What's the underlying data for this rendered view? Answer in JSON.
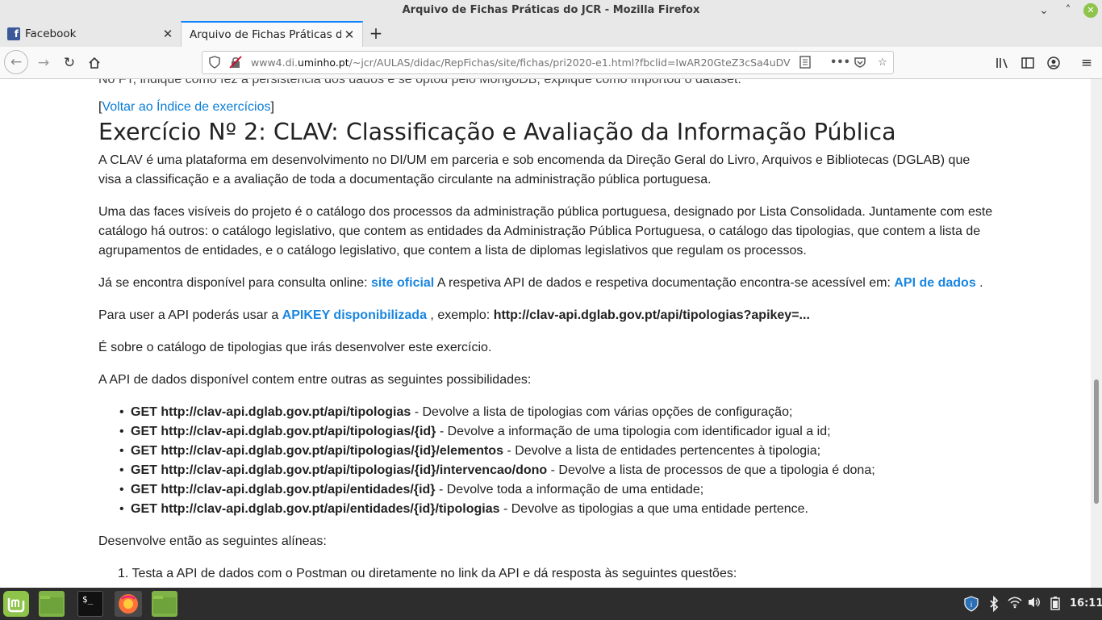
{
  "window": {
    "title": "Arquivo de Fichas Práticas do JCR - Mozilla Firefox"
  },
  "tabs": [
    {
      "label": "Facebook",
      "favicon": "facebook-icon"
    },
    {
      "label": "Arquivo de Fichas Práticas do J"
    }
  ],
  "nav": {
    "url_prefix": "www4.di.",
    "url_domain": "uminho.pt",
    "url_rest": "/~jcr/AULAS/didac/RepFichas/site/fichas/pri2020-e1.html?fbclid=IwAR20GteZ3cSa4uDV"
  },
  "content": {
    "cutoff_text": "No FT, indique como fez a persistência dos dados e se optou pelo MongoDB, explique como importou o dataset.",
    "back_link_open": "[",
    "back_link": "Voltar ao Índice de exercícios",
    "back_link_close": "]",
    "heading": "Exercício Nº 2: CLAV: Classificação e Avaliação da Informação Pública",
    "p1": "A CLAV é uma plataforma em desenvolvimento no DI/UM em parceria e sob encomenda da Direção Geral do Livro, Arquivos e Bibliotecas (DGLAB) que visa a classificação e a avaliação de toda a documentação circulante na administração pública portuguesa.",
    "p2": "Uma das faces visíveis do projeto é o catálogo dos processos da administração pública portuguesa, designado por Lista Consolidada. Juntamente com este catálogo há outros: o catálogo legislativo, que contem as entidades da Administração Pública Portuguesa, o catálogo das tipologias, que contem a lista de agrupamentos de entidades, e o catálogo legislativo, que contem a lista de diplomas legislativos que regulam os processos.",
    "p3_a": "Já se encontra disponível para consulta online: ",
    "p3_link1": "site oficial",
    "p3_b": " A respetiva API de dados e respetiva documentação encontra-se acessível em: ",
    "p3_link2": "API de dados",
    "p3_c": " .",
    "p4_a": "Para user a API poderás usar a ",
    "p4_link": "APIKEY disponibilizada",
    "p4_b": " , exemplo: ",
    "p4_code": "http://clav-api.dglab.gov.pt/api/tipologias?apikey=...",
    "p5": "É sobre o catálogo de tipologias que irás desenvolver este exercício.",
    "p6": "A API de dados disponível contem entre outras as seguintes possibilidades:",
    "api_items": [
      {
        "endpoint": "GET http://clav-api.dglab.gov.pt/api/tipologias",
        "desc": " - Devolve a lista de tipologias com várias opções de configuração;"
      },
      {
        "endpoint": "GET http://clav-api.dglab.gov.pt/api/tipologias/{id}",
        "desc": " - Devolve a informação de uma tipologia com identificador igual a id;"
      },
      {
        "endpoint": "GET http://clav-api.dglab.gov.pt/api/tipologias/{id}/elementos",
        "desc": " - Devolve a lista de entidades pertencentes à tipologia;"
      },
      {
        "endpoint": "GET http://clav-api.dglab.gov.pt/api/tipologias/{id}/intervencao/dono",
        "desc": " - Devolve a lista de processos de que a tipologia é dona;"
      },
      {
        "endpoint": "GET http://clav-api.dglab.gov.pt/api/entidades/{id}",
        "desc": " - Devolve toda a informação de uma entidade;"
      },
      {
        "endpoint": "GET http://clav-api.dglab.gov.pt/api/entidades/{id}/tipologias",
        "desc": " - Devolve as tipologias a que uma entidade pertence."
      }
    ],
    "p7": "Desenvolve então as seguintes alíneas:",
    "task1": "1. Testa a API de dados com o Postman ou diretamente no link da API e dá resposta às seguintes questões:"
  },
  "taskbar": {
    "clock": "16:11"
  },
  "colors": {
    "link": "#0a7dd6",
    "accent": "#0a84ff",
    "mint": "#8fc44b"
  }
}
